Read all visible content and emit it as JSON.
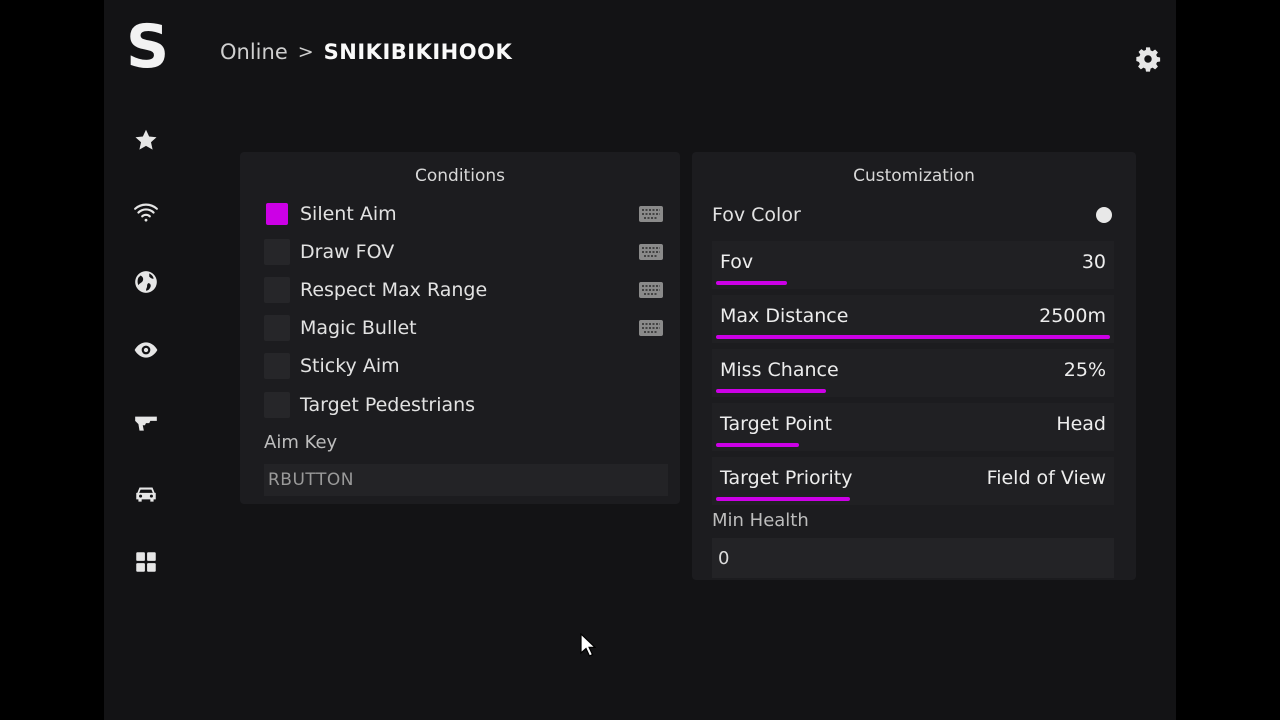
{
  "app": {
    "logo_letter": "S",
    "accent_color": "#cc00e6",
    "sidebar_icons": [
      "star-icon",
      "wifi-icon",
      "globe-icon",
      "eye-icon",
      "gun-icon",
      "car-icon",
      "grid-icon"
    ]
  },
  "breadcrumb": {
    "parent": "Online",
    "separator": ">",
    "current": "SNIKIBIKIHOOK"
  },
  "conditions": {
    "title": "Conditions",
    "items": [
      {
        "label": "Silent Aim",
        "checked": true,
        "has_keybind": true
      },
      {
        "label": "Draw FOV",
        "checked": false,
        "has_keybind": true
      },
      {
        "label": "Respect Max Range",
        "checked": false,
        "has_keybind": true
      },
      {
        "label": "Magic Bullet",
        "checked": false,
        "has_keybind": true
      },
      {
        "label": "Sticky Aim",
        "checked": false,
        "has_keybind": false
      },
      {
        "label": "Target Pedestrians",
        "checked": false,
        "has_keybind": false
      }
    ],
    "aim_key_label": "Aim Key",
    "aim_key_value": "RBUTTON"
  },
  "customization": {
    "title": "Customization",
    "fov_color_label": "Fov Color",
    "fov_color_value": "#e8e8e8",
    "sliders": [
      {
        "label": "Fov",
        "value": "30",
        "fill_fraction": 0.18
      },
      {
        "label": "Max Distance",
        "value": "2500m",
        "fill_fraction": 1.0
      },
      {
        "label": "Miss Chance",
        "value": "25%",
        "fill_fraction": 0.28
      },
      {
        "label": "Target Point",
        "value": "Head",
        "fill_fraction": 0.21
      },
      {
        "label": "Target Priority",
        "value": "Field of View",
        "fill_fraction": 0.34
      }
    ],
    "min_health_label": "Min Health",
    "min_health_value": "0"
  }
}
